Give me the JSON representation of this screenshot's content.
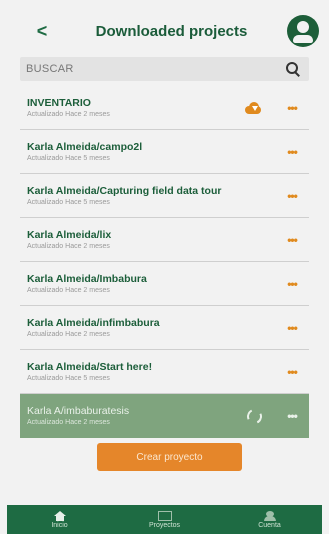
{
  "header": {
    "back_label": "<",
    "title": "Downloaded projects"
  },
  "search": {
    "placeholder": "BUSCAR"
  },
  "projects": [
    {
      "title": "INVENTARIO",
      "subtitle": "Actualizado Hace 2 meses",
      "status_icon": "cloud-download-icon"
    },
    {
      "title": "Karla Almeida/campo2l",
      "subtitle": "Actualizado Hace 5 meses"
    },
    {
      "title": "Karla Almeida/Capturing field data tour",
      "subtitle": "Actualizado Hace 5 meses"
    },
    {
      "title": "Karla Almeida/lix",
      "subtitle": "Actualizado Hace 2 meses"
    },
    {
      "title": "Karla Almeida/Imbabura",
      "subtitle": "Actualizado Hace 2 meses"
    },
    {
      "title": "Karla Almeida/infimbabura",
      "subtitle": "Actualizado Hace 2 meses"
    },
    {
      "title": "Karla Almeida/Start here!",
      "subtitle": "Actualizado Hace 5 meses"
    },
    {
      "title": "Karla A/imbaburatesis",
      "subtitle": "Actualizado Hace 2 meses",
      "status_icon": "sync-icon",
      "selected": true
    }
  ],
  "more_label": "•••",
  "create_button": "Crear proyecto",
  "bottom_nav": [
    {
      "label": "Inicio",
      "icon": "home-icon"
    },
    {
      "label": "Proyectos",
      "icon": "map-icon"
    },
    {
      "label": "Cuenta",
      "icon": "people-icon"
    }
  ],
  "colors": {
    "primary_green": "#1e6b43",
    "accent_orange": "#e5862a",
    "selected_row": "#7fa47e"
  }
}
